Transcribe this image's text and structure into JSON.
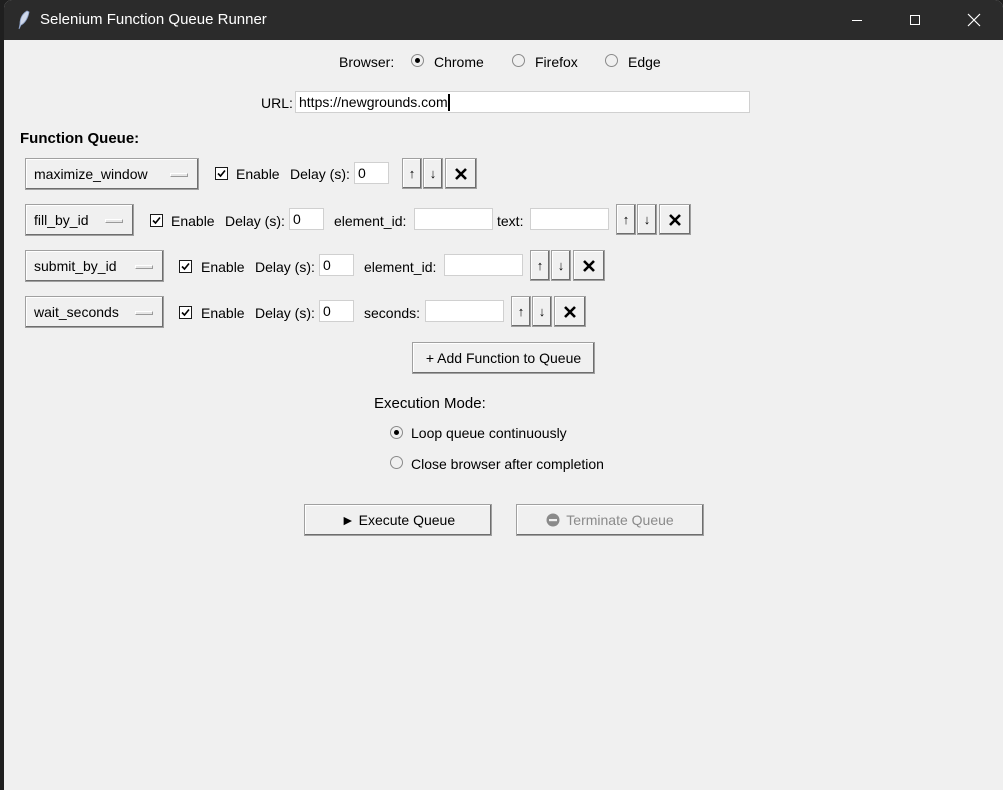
{
  "window": {
    "title": "Selenium Function Queue Runner"
  },
  "browser": {
    "label": "Browser:",
    "options": [
      {
        "label": "Chrome",
        "selected": true
      },
      {
        "label": "Firefox",
        "selected": false
      },
      {
        "label": "Edge",
        "selected": false
      }
    ]
  },
  "url": {
    "label": "URL:",
    "value": "https://newgrounds.com"
  },
  "queue": {
    "header": "Function Queue:",
    "enable_label": "Enable",
    "delay_label": "Delay (s):",
    "items": [
      {
        "function": "maximize_window",
        "enabled": true,
        "delay": "0",
        "params": []
      },
      {
        "function": "fill_by_id",
        "enabled": true,
        "delay": "0",
        "params": [
          {
            "label": "element_id:",
            "value": ""
          },
          {
            "label": "text:",
            "value": ""
          }
        ]
      },
      {
        "function": "submit_by_id",
        "enabled": true,
        "delay": "0",
        "params": [
          {
            "label": "element_id:",
            "value": ""
          }
        ]
      },
      {
        "function": "wait_seconds",
        "enabled": true,
        "delay": "0",
        "params": [
          {
            "label": "seconds:",
            "value": ""
          }
        ]
      }
    ],
    "up_symbol": "↑",
    "down_symbol": "↓",
    "add_label": "+ Add Function to Queue"
  },
  "execution": {
    "label": "Execution Mode:",
    "options": [
      {
        "label": "Loop queue continuously",
        "selected": true
      },
      {
        "label": "Close browser after completion",
        "selected": false
      }
    ]
  },
  "actions": {
    "execute_label": "► Execute Queue",
    "terminate_label": "Terminate Queue",
    "terminate_icon": "stop-circle-icon"
  },
  "colors": {
    "titlebar": "#2b2b2b",
    "window_bg": "#f0f0f0",
    "disabled_text": "#8a8a8a"
  }
}
